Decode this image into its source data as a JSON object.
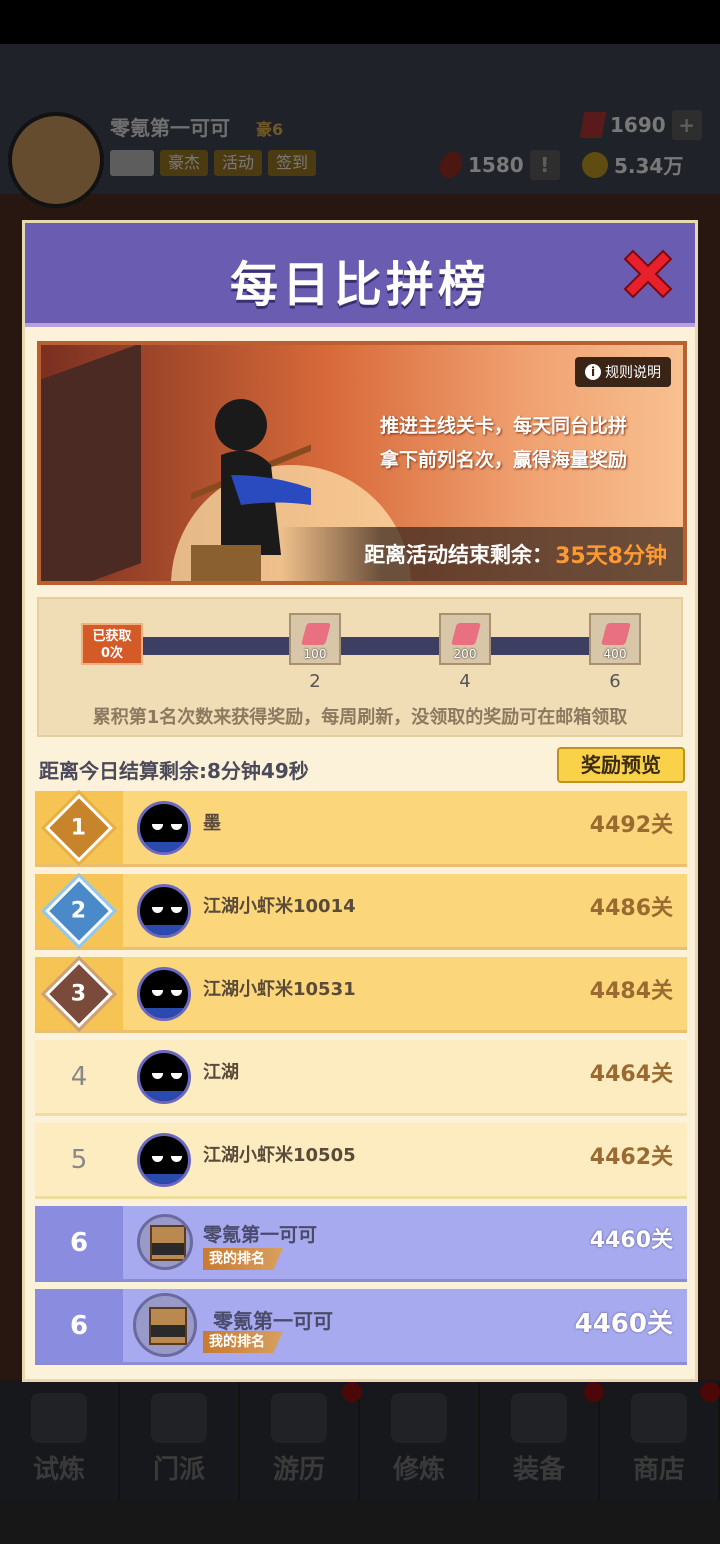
{
  "background": {
    "player_name": "零氪第一可可",
    "vip": "豪6",
    "top_buttons": [
      "豪杰",
      "活动",
      "签到"
    ],
    "gems": "1690",
    "tokens": "1580",
    "coins": "5.34万",
    "nav": [
      "试炼",
      "门派",
      "游历",
      "修炼",
      "装备",
      "商店"
    ]
  },
  "dialog": {
    "title": "每日比拼榜",
    "rules_label": "规则说明",
    "banner_line1": "推进主线关卡，每天同台比拼",
    "banner_line2": "拿下前列名次，赢得海量奖励",
    "countdown_label": "距离活动结束剩余：",
    "countdown_value": "35天8分钟",
    "obtained_line1": "已获取",
    "obtained_line2": "0次",
    "rewards": [
      {
        "amount": "100",
        "count": "2"
      },
      {
        "amount": "200",
        "count": "4"
      },
      {
        "amount": "400",
        "count": "6"
      }
    ],
    "progress_hint": "累积第1名次数来获得奖励，每周刷新，没领取的奖励可在邮箱领取",
    "settle_text": "距离今日结算剩余:8分钟49秒",
    "preview_label": "奖励预览",
    "my_rank_label": "我的排名",
    "ranks": [
      {
        "rank": "1",
        "name": "墨",
        "score": "4492关"
      },
      {
        "rank": "2",
        "name": "江湖小虾米10014",
        "score": "4486关"
      },
      {
        "rank": "3",
        "name": "江湖小虾米10531",
        "score": "4484关"
      },
      {
        "rank": "4",
        "name": "江湖",
        "score": "4464关"
      },
      {
        "rank": "5",
        "name": "江湖小虾米10505",
        "score": "4462关"
      },
      {
        "rank": "6",
        "name": "零氪第一可可",
        "score": "4460关"
      }
    ],
    "my_entry": {
      "rank": "6",
      "name": "零氪第一可可",
      "score": "4460关"
    }
  },
  "colors": {
    "header": "#6a5cb0",
    "accent_gold": "#fad24a",
    "countdown": "#ff9a30",
    "my_row": "#a8aaf0"
  }
}
